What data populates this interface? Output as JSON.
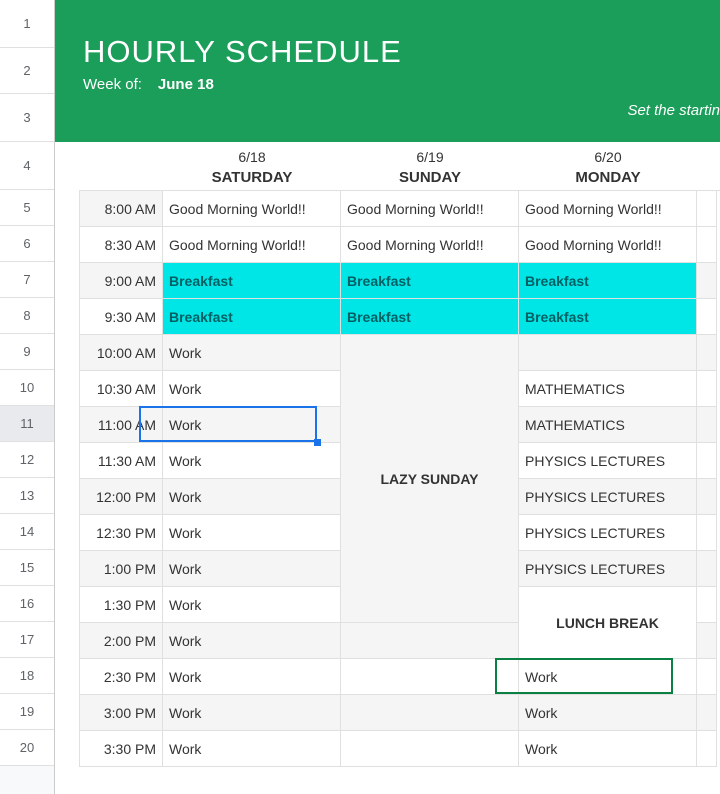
{
  "header": {
    "title": "HOURLY SCHEDULE",
    "week_of_label": "Week of:",
    "week_of_value": "June 18",
    "right_hint": "Set the startin"
  },
  "row_numbers": [
    1,
    2,
    3,
    4,
    5,
    6,
    7,
    8,
    9,
    10,
    11,
    12,
    13,
    14,
    15,
    16,
    17,
    18,
    19,
    20
  ],
  "selected_row_number": 11,
  "days": [
    {
      "date": "6/18",
      "name": "SATURDAY"
    },
    {
      "date": "6/19",
      "name": "SUNDAY"
    },
    {
      "date": "6/20",
      "name": "MONDAY"
    }
  ],
  "times": [
    "8:00 AM",
    "8:30 AM",
    "9:00 AM",
    "9:30 AM",
    "10:00 AM",
    "10:30 AM",
    "11:00 AM",
    "11:30 AM",
    "12:00 PM",
    "12:30 PM",
    "1:00 PM",
    "1:30 PM",
    "2:00 PM",
    "2:30 PM",
    "3:00 PM",
    "3:30 PM"
  ],
  "schedule": {
    "saturday": [
      "Good Morning World!!",
      "Good Morning World!!",
      "Breakfast",
      "Breakfast",
      "Work",
      "Work",
      "Work",
      "Work",
      "Work",
      "Work",
      "Work",
      "Work",
      "Work",
      "Work",
      "Work",
      "Work"
    ],
    "sunday": [
      "Good Morning World!!",
      "Good Morning World!!",
      "Breakfast",
      "Breakfast",
      "LAZY SUNDAY",
      "",
      "",
      "",
      "",
      "",
      "",
      "",
      "",
      "",
      "",
      ""
    ],
    "monday": [
      "Good Morning World!!",
      "Good Morning World!!",
      "Breakfast",
      "Breakfast",
      "",
      "MATHEMATICS",
      "MATHEMATICS",
      "PHYSICS LECTURES",
      "PHYSICS LECTURES",
      "PHYSICS LECTURES",
      "PHYSICS LECTURES",
      "LUNCH BREAK",
      "",
      "Work",
      "Work",
      "Work"
    ]
  },
  "highlights": {
    "breakfast_rows": [
      2,
      3
    ],
    "breakfast_style": "cyan",
    "sunday_merge": {
      "label_key": "schedule.sunday.4",
      "row_start": 5,
      "row_end": 12
    },
    "monday_lunch_merge": {
      "label_key": "schedule.monday.11",
      "row_start": 12,
      "row_end": 13
    },
    "selected_cell": {
      "day": "saturday",
      "row_index": 6
    },
    "green_outline": {
      "day": "monday",
      "row_index": 13
    }
  },
  "colors": {
    "banner_bg": "#1b9e5a",
    "cyan_bg": "#00e5e5",
    "selection_blue": "#1a73e8",
    "green_outline": "#0b8043"
  }
}
